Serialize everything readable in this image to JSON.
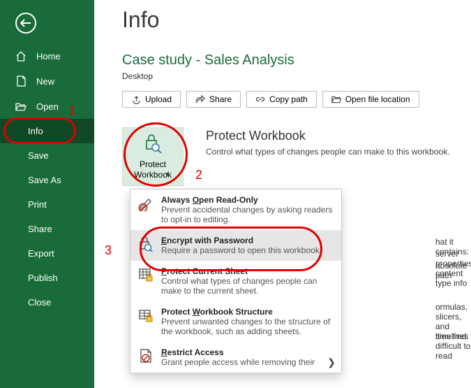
{
  "sidebar": {
    "home": "Home",
    "new": "New",
    "open": "Open",
    "info": "Info",
    "save": "Save",
    "saveas": "Save As",
    "print": "Print",
    "share": "Share",
    "export": "Export",
    "publish": "Publish",
    "close": "Close"
  },
  "page": {
    "title": "Info",
    "doc_title": "Case study - Sales Analysis",
    "doc_location": "Desktop"
  },
  "actions": {
    "upload": "Upload",
    "share": "Share",
    "copy_path": "Copy path",
    "open_location": "Open file location"
  },
  "protect": {
    "btn_line1": "Protect",
    "btn_line2": "Workbook",
    "title": "Protect Workbook",
    "desc": "Control what types of changes people can make to this workbook."
  },
  "dropdown": {
    "readonly_t": "Always Open Read-Only",
    "readonly_d": "Prevent accidental changes by asking readers to opt-in to editing.",
    "encrypt_t": "Encrypt with Password",
    "encrypt_d": "Require a password to open this workbook.",
    "sheet_t": "Protect Current Sheet",
    "sheet_d": "Control what types of changes people can make to the current sheet.",
    "struct_t": "Protect Workbook Structure",
    "struct_d": "Prevent unwanted changes to the structure of the workbook, such as adding sheets.",
    "restrict_t": "Restrict Access",
    "restrict_d": "Grant people access while removing their"
  },
  "behind": {
    "l1": "hat it contains:",
    "l2": "server properties, content type info",
    "l3": "absolute path",
    "l4": "ormulas, slicers, and timelines",
    "l5": "ities find difficult to read"
  },
  "annotations": {
    "n1": "1",
    "n2": "2",
    "n3": "3"
  }
}
